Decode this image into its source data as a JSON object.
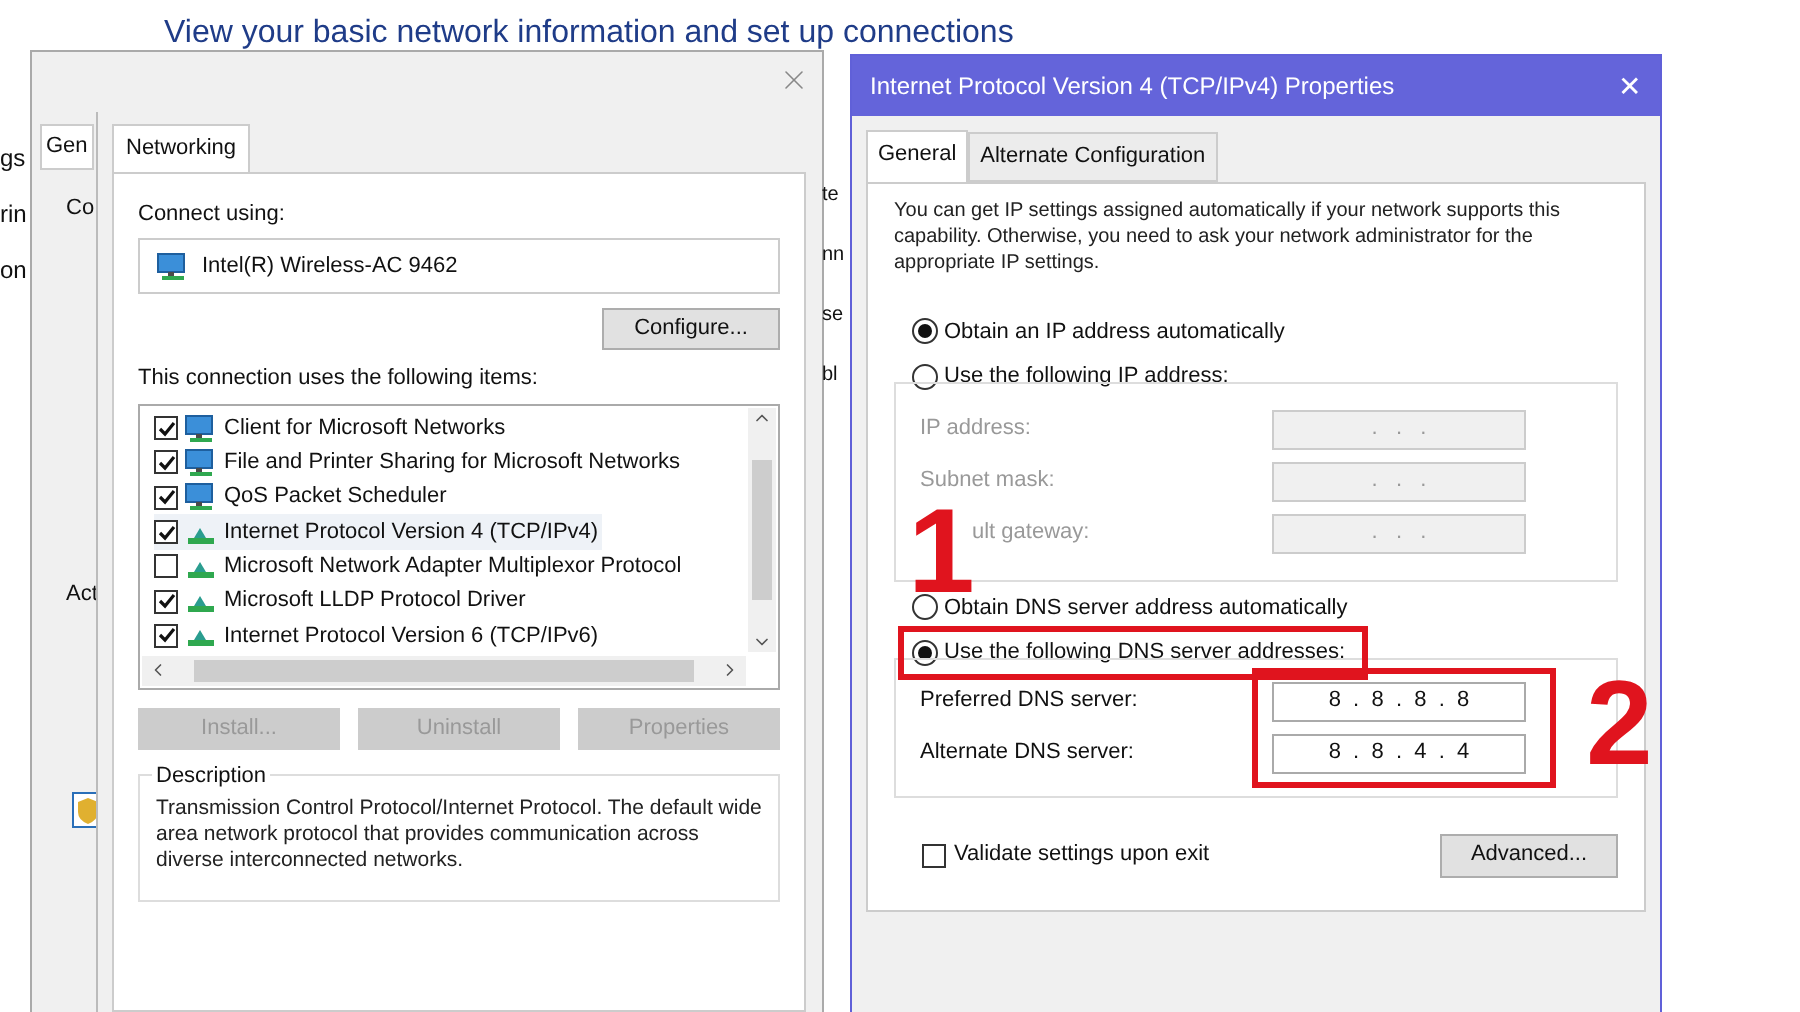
{
  "background": {
    "heading": "View your basic network information and set up connections",
    "left_fragments": [
      "gs",
      "rin",
      "on"
    ],
    "middle_fragments": [
      "te",
      "nn",
      "se",
      "bl"
    ]
  },
  "outer_dialog": {
    "tab": "Gen",
    "fragments": [
      "Co",
      "Act"
    ]
  },
  "adapter_dialog": {
    "tabs": [
      {
        "label": "Networking",
        "selected": true
      }
    ],
    "connect_using_label": "Connect using:",
    "adapter": "Intel(R) Wireless-AC 9462",
    "configure_button": "Configure...",
    "items_label": "This connection uses the following items:",
    "items": [
      {
        "label": "Client for Microsoft Networks",
        "checked": true,
        "kind": "client",
        "selected": false
      },
      {
        "label": "File and Printer Sharing for Microsoft Networks",
        "checked": true,
        "kind": "client",
        "selected": false
      },
      {
        "label": "QoS Packet Scheduler",
        "checked": true,
        "kind": "client",
        "selected": false
      },
      {
        "label": "Internet Protocol Version 4 (TCP/IPv4)",
        "checked": true,
        "kind": "protocol",
        "selected": true
      },
      {
        "label": "Microsoft Network Adapter Multiplexor Protocol",
        "checked": false,
        "kind": "protocol",
        "selected": false
      },
      {
        "label": "Microsoft LLDP Protocol Driver",
        "checked": true,
        "kind": "protocol",
        "selected": false
      },
      {
        "label": "Internet Protocol Version 6 (TCP/IPv6)",
        "checked": true,
        "kind": "protocol",
        "selected": false
      }
    ],
    "buttons": [
      {
        "label": "Install...",
        "disabled": true
      },
      {
        "label": "Uninstall",
        "disabled": true
      },
      {
        "label": "Properties",
        "disabled": true
      }
    ],
    "description_title": "Description",
    "description": "Transmission Control Protocol/Internet Protocol. The default wide area network protocol that provides communication across diverse interconnected networks."
  },
  "ipv4_dialog": {
    "title": "Internet Protocol Version 4 (TCP/IPv4) Properties",
    "close": "✕",
    "tabs": [
      {
        "label": "General",
        "selected": true
      },
      {
        "label": "Alternate Configuration",
        "selected": false
      }
    ],
    "intro": "You can get IP settings assigned automatically if your network supports this capability. Otherwise, you need to ask your network administrator for the appropriate IP settings.",
    "ip_radios": [
      {
        "label": "Obtain an IP address automatically",
        "selected": true
      },
      {
        "label": "Use the following IP address:",
        "selected": false
      }
    ],
    "ip_fields": [
      {
        "label": "IP address:",
        "value": ".   .   .",
        "disabled": true
      },
      {
        "label": "Subnet mask:",
        "value": ".   .   .",
        "disabled": true
      },
      {
        "label": "ult gateway:",
        "value": ".   .   .",
        "disabled": true
      }
    ],
    "dns_radios": [
      {
        "label": "Obtain DNS server address automatically",
        "selected": false
      },
      {
        "label": "Use the following DNS server addresses:",
        "selected": true
      }
    ],
    "dns_fields": [
      {
        "label": "Preferred DNS server:",
        "value": "8  .  8  .  8  .  8",
        "disabled": false
      },
      {
        "label": "Alternate DNS server:",
        "value": "8  .  8  .  4  .  4",
        "disabled": false
      }
    ],
    "validate": {
      "label": "Validate settings upon exit",
      "checked": false
    },
    "advanced_button": "Advanced..."
  },
  "annotations": [
    {
      "label": "1"
    },
    {
      "label": "2"
    }
  ]
}
